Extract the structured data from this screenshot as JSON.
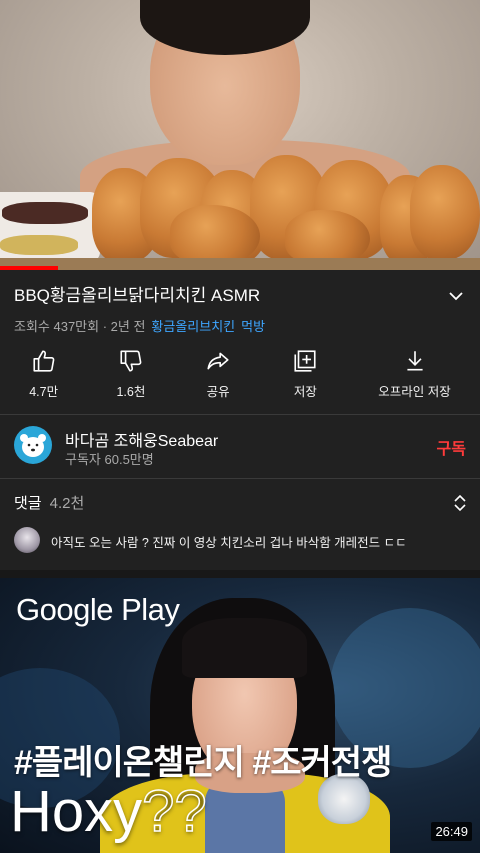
{
  "video": {
    "title": "BBQ황금올리브닭다리치킨 ASMR",
    "views": "조회수 437만회 · 2년 전",
    "tags": [
      "황금올리브치킨",
      "먹방"
    ],
    "progress_fraction": 0.12
  },
  "actions": [
    {
      "icon": "thumbs-up-icon",
      "label": "4.7만"
    },
    {
      "icon": "thumbs-down-icon",
      "label": "1.6천"
    },
    {
      "icon": "share-icon",
      "label": "공유"
    },
    {
      "icon": "save-playlist-icon",
      "label": "저장"
    },
    {
      "icon": "download-icon",
      "label": "오프라인 저장"
    }
  ],
  "channel": {
    "name": "바다곰 조해웅Seabear",
    "subscribers": "구독자 60.5만명",
    "subscribe_label": "구독"
  },
  "comments": {
    "label": "댓글",
    "count": "4.2천",
    "top_comment": "아직도 오는 사람 ? 진짜 이 영상 치킨소리 겁나 바삭함 개레전드 ㄷㄷ"
  },
  "ad": {
    "brand": "Google Play",
    "hashtags": "#플레이온챌린지 #조커전쟁",
    "headline": "Hoxy",
    "headline_suffix": "??",
    "duration": "26:49"
  },
  "colors": {
    "background": "#212121",
    "accent_link": "#3ea6ff",
    "subscribe": "#ff3b3b",
    "progress": "#ff0000"
  }
}
